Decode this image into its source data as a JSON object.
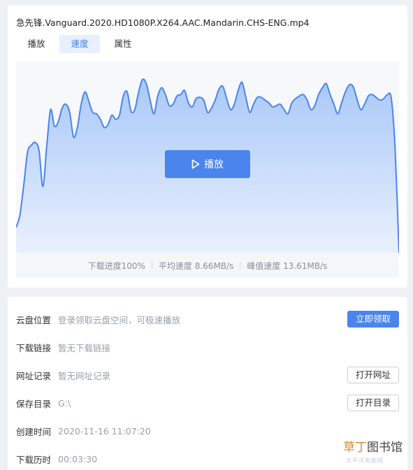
{
  "file": {
    "title": "急先锋.Vanguard.2020.HD1080P.X264.AAC.Mandarin.CHS-ENG.mp4"
  },
  "tabs": [
    {
      "label": "播放",
      "active": false
    },
    {
      "label": "速度",
      "active": true
    },
    {
      "label": "属性",
      "active": false
    }
  ],
  "chart": {
    "play_label": "播放"
  },
  "stats": {
    "progress": "下载进度100%",
    "avg_speed": "平均速度 8.66MB/s",
    "peak_speed": "峰值速度 13.61MB/s"
  },
  "chart_data": {
    "type": "area",
    "title": "",
    "xlabel": "",
    "ylabel": "",
    "x": [
      0,
      0.01,
      0.02,
      0.03,
      0.04,
      0.05,
      0.06,
      0.07,
      0.08,
      0.09,
      0.1,
      0.11,
      0.12,
      0.13,
      0.14,
      0.15,
      0.16,
      0.17,
      0.18,
      0.19,
      0.2,
      0.21,
      0.22,
      0.23,
      0.24,
      0.25,
      0.26,
      0.27,
      0.28,
      0.29,
      0.3,
      0.31,
      0.32,
      0.33,
      0.34,
      0.35,
      0.36,
      0.37,
      0.38,
      0.39,
      0.4,
      0.41,
      0.42,
      0.43,
      0.44,
      0.45,
      0.46,
      0.47,
      0.48,
      0.49,
      0.5,
      0.51,
      0.52,
      0.53,
      0.54,
      0.55,
      0.56,
      0.57,
      0.58,
      0.59,
      0.6,
      0.61,
      0.62,
      0.63,
      0.64,
      0.65,
      0.66,
      0.67,
      0.68,
      0.69,
      0.7,
      0.71,
      0.72,
      0.73,
      0.74,
      0.75,
      0.76,
      0.77,
      0.78,
      0.79,
      0.8,
      0.81,
      0.82,
      0.83,
      0.84,
      0.85,
      0.86,
      0.87,
      0.88,
      0.89,
      0.9,
      0.91,
      0.92,
      0.93,
      0.94,
      0.95,
      0.96,
      0.97,
      0.98,
      0.99,
      1.0
    ],
    "values": [
      1.9,
      2.8,
      5.0,
      7.4,
      7.9,
      8.1,
      7.5,
      4.9,
      7.8,
      10.5,
      9.3,
      9.6,
      10.6,
      10.9,
      10.3,
      8.5,
      9.2,
      10.9,
      11.8,
      11.1,
      10.3,
      10.2,
      9.8,
      9.2,
      9.4,
      10.1,
      9.8,
      10.1,
      11.5,
      11.8,
      10.4,
      10.5,
      11.8,
      12.7,
      12.4,
      11.2,
      10.2,
      11.5,
      12.1,
      11.6,
      10.8,
      10.9,
      11.5,
      11.6,
      11.9,
      11.0,
      10.7,
      11.3,
      11.4,
      11.2,
      10.3,
      10.6,
      11.2,
      12.0,
      12.2,
      11.3,
      10.5,
      10.9,
      11.9,
      12.5,
      11.4,
      10.3,
      10.9,
      11.4,
      11.4,
      11.2,
      11.0,
      10.7,
      10.8,
      10.9,
      10.5,
      10.2,
      11.0,
      11.3,
      11.5,
      11.6,
      11.2,
      10.5,
      10.8,
      11.6,
      12.1,
      12.4,
      11.6,
      10.9,
      10.2,
      11.0,
      11.8,
      12.3,
      12.2,
      11.3,
      10.5,
      10.9,
      11.5,
      11.6,
      11.4,
      11.2,
      11.3,
      11.6,
      11.3,
      7.5,
      0.0
    ],
    "ylim": [
      0,
      13.61
    ]
  },
  "details": {
    "cloud": {
      "label": "云盘位置",
      "value": "登录领取云盘空间，可极速播放",
      "button": "立即领取"
    },
    "link": {
      "label": "下载链接",
      "value": "暂无下载链接"
    },
    "url": {
      "label": "网址记录",
      "value": "暂无网址记录",
      "button": "打开网址"
    },
    "dir": {
      "label": "保存目录",
      "value": "G:\\",
      "button": "打开目录"
    },
    "created": {
      "label": "创建时间",
      "value": "2020-11-16 11:07:20"
    },
    "duration": {
      "label": "下载历时",
      "value": "00:03:30"
    }
  },
  "watermark": {
    "text_a": "草丁",
    "text_b": "图书馆",
    "sub": "太平洋电脑网"
  },
  "colors": {
    "accent": "#4a85ee",
    "area_top": "#a9c8f8",
    "area_bottom": "#eaf1fd",
    "line": "#4a85ee"
  },
  "icons": {
    "play": "play-triangle-icon"
  }
}
